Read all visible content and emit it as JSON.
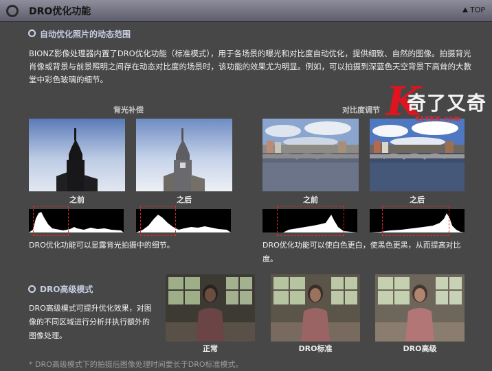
{
  "header": {
    "title": "DRO优化功能",
    "top_label": "TOP"
  },
  "section1": {
    "title": "自动优化照片的动态范围",
    "paragraph": "BIONZ影像处理器内置了DRO优化功能（标准模式），用于各场景的曝光和对比度自动优化，提供细致、自然的图像。拍摄背光肖像或背景与前景照明之间存在动态对比度的场景时，该功能的效果尤为明显。例如，可以拍摄到深蓝色天空背景下高耸的大教堂中彩色玻璃的细节。"
  },
  "backlight": {
    "title": "背光补偿",
    "before_label": "之前",
    "after_label": "之后",
    "description": "DRO优化功能可以显露背光拍摄中的细节。"
  },
  "contrast": {
    "title": "对比度调节",
    "before_label": "之前",
    "after_label": "之后",
    "description": "DRO优化功能可以使白色更白，使黑色更黑，从而提高对比度。"
  },
  "section2": {
    "title": "DRO高级模式",
    "description": "DRO高级模式可提升优化效果，对图像的不同区域进行分析并执行额外的图像处理。",
    "photos": [
      "正常",
      "DRO标准",
      "DRO高级"
    ]
  },
  "footnote": "* DRO高级模式下的拍摄后图像处理时间要长于DRO标准模式。",
  "watermark": {
    "chinese": "奇了又奇",
    "letter": "K",
    "url": "KLYKK.com"
  },
  "colors": {
    "accent_text": "#c5cde2",
    "histogram_box": "#e02828",
    "watermark_red": "#e0141e"
  }
}
